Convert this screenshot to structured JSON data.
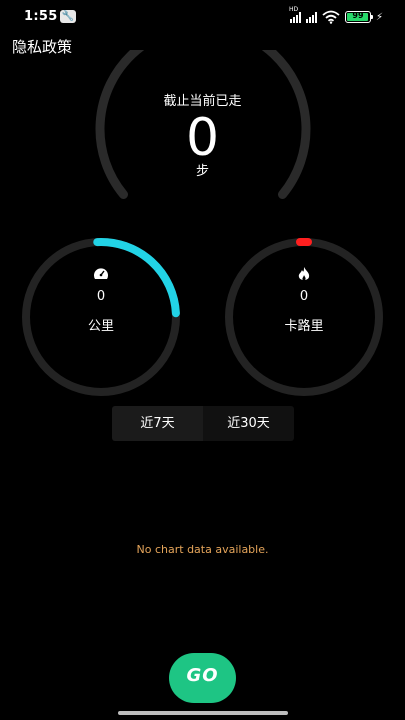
{
  "status_bar": {
    "time": "1:55",
    "battery": "99"
  },
  "header": {
    "privacy_policy": "隐私政策"
  },
  "steps": {
    "label": "截止当前已走",
    "value": "0",
    "unit": "步"
  },
  "distance": {
    "icon": "speedometer-icon",
    "value": "0",
    "unit": "公里",
    "progress": 0.25,
    "color": "#22d3e6"
  },
  "calories": {
    "icon": "flame-icon",
    "value": "0",
    "unit": "卡路里",
    "color": "#ff1f1f"
  },
  "tabs": [
    {
      "label": "近7天",
      "active": true
    },
    {
      "label": "近30天",
      "active": false
    }
  ],
  "chart": {
    "empty_message": "No chart data available."
  },
  "go_button": {
    "label": "GO",
    "color": "#1ec584"
  }
}
